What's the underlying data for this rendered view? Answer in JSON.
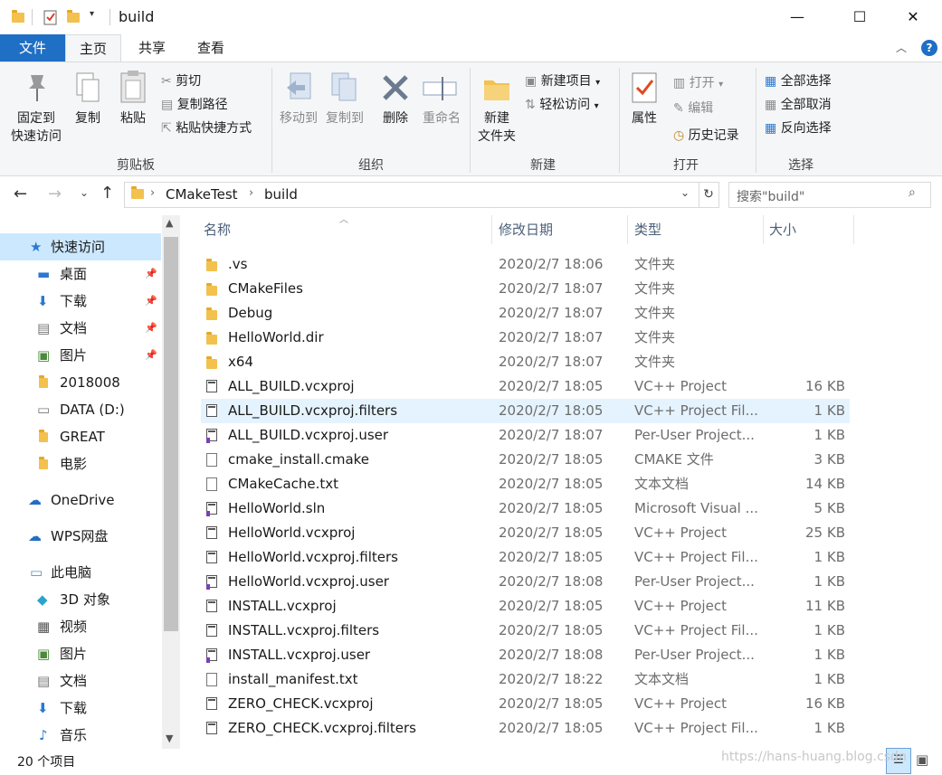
{
  "title": "build",
  "tabs": [
    {
      "label": "文件"
    },
    {
      "label": "主页"
    },
    {
      "label": "共享"
    },
    {
      "label": "查看"
    }
  ],
  "ribbon": {
    "clipboard": {
      "pin_label": "固定到\n快速访问",
      "copy_label": "复制",
      "paste_label": "粘贴",
      "cut_label": "剪切",
      "copy_path_label": "复制路径",
      "paste_shortcut_label": "粘贴快捷方式",
      "group_label": "剪贴板"
    },
    "organize": {
      "move_to_label": "移动到",
      "copy_to_label": "复制到",
      "delete_label": "删除",
      "rename_label": "重命名",
      "group_label": "组织"
    },
    "new": {
      "new_folder_label": "新建\n文件夹",
      "new_item_label": "新建项目",
      "easy_access_label": "轻松访问",
      "group_label": "新建"
    },
    "open": {
      "properties_label": "属性",
      "open_label": "打开",
      "edit_label": "编辑",
      "history_label": "历史记录",
      "group_label": "打开"
    },
    "select": {
      "select_all_label": "全部选择",
      "select_none_label": "全部取消",
      "invert_label": "反向选择",
      "group_label": "选择"
    }
  },
  "address": {
    "crumbs": [
      "CMakeTest",
      "build"
    ],
    "search_placeholder": "搜索\"build\""
  },
  "sidebar": {
    "items": [
      {
        "label": "快速访问",
        "pinned": false
      },
      {
        "label": "桌面",
        "pinned": true
      },
      {
        "label": "下载",
        "pinned": true
      },
      {
        "label": "文档",
        "pinned": true
      },
      {
        "label": "图片",
        "pinned": true
      },
      {
        "label": "2018008",
        "pinned": false
      },
      {
        "label": "DATA (D:)",
        "pinned": false
      },
      {
        "label": "GREAT",
        "pinned": false
      },
      {
        "label": "电影",
        "pinned": false
      },
      {
        "label": "OneDrive",
        "pinned": false
      },
      {
        "label": "WPS网盘",
        "pinned": false
      },
      {
        "label": "此电脑",
        "pinned": false
      },
      {
        "label": "3D 对象",
        "pinned": false
      },
      {
        "label": "视频",
        "pinned": false
      },
      {
        "label": "图片",
        "pinned": false
      },
      {
        "label": "文档",
        "pinned": false
      },
      {
        "label": "下载",
        "pinned": false
      },
      {
        "label": "音乐",
        "pinned": false
      }
    ]
  },
  "columns": {
    "name": "名称",
    "date": "修改日期",
    "type": "类型",
    "size": "大小"
  },
  "files": [
    {
      "name": ".vs",
      "date": "2020/2/7 18:06",
      "type": "文件夹",
      "size": "",
      "kind": "folder"
    },
    {
      "name": "CMakeFiles",
      "date": "2020/2/7 18:07",
      "type": "文件夹",
      "size": "",
      "kind": "folder"
    },
    {
      "name": "Debug",
      "date": "2020/2/7 18:07",
      "type": "文件夹",
      "size": "",
      "kind": "folder"
    },
    {
      "name": "HelloWorld.dir",
      "date": "2020/2/7 18:07",
      "type": "文件夹",
      "size": "",
      "kind": "folder"
    },
    {
      "name": "x64",
      "date": "2020/2/7 18:07",
      "type": "文件夹",
      "size": "",
      "kind": "folder"
    },
    {
      "name": "ALL_BUILD.vcxproj",
      "date": "2020/2/7 18:05",
      "type": "VC++ Project",
      "size": "16 KB",
      "kind": "vcx"
    },
    {
      "name": "ALL_BUILD.vcxproj.filters",
      "date": "2020/2/7 18:05",
      "type": "VC++ Project Fil...",
      "size": "1 KB",
      "kind": "vcx"
    },
    {
      "name": "ALL_BUILD.vcxproj.user",
      "date": "2020/2/7 18:07",
      "type": "Per-User Project...",
      "size": "1 KB",
      "kind": "user"
    },
    {
      "name": "cmake_install.cmake",
      "date": "2020/2/7 18:05",
      "type": "CMAKE 文件",
      "size": "3 KB",
      "kind": "file"
    },
    {
      "name": "CMakeCache.txt",
      "date": "2020/2/7 18:05",
      "type": "文本文档",
      "size": "14 KB",
      "kind": "file"
    },
    {
      "name": "HelloWorld.sln",
      "date": "2020/2/7 18:05",
      "type": "Microsoft Visual ...",
      "size": "5 KB",
      "kind": "user"
    },
    {
      "name": "HelloWorld.vcxproj",
      "date": "2020/2/7 18:05",
      "type": "VC++ Project",
      "size": "25 KB",
      "kind": "vcx"
    },
    {
      "name": "HelloWorld.vcxproj.filters",
      "date": "2020/2/7 18:05",
      "type": "VC++ Project Fil...",
      "size": "1 KB",
      "kind": "vcx"
    },
    {
      "name": "HelloWorld.vcxproj.user",
      "date": "2020/2/7 18:08",
      "type": "Per-User Project...",
      "size": "1 KB",
      "kind": "user"
    },
    {
      "name": "INSTALL.vcxproj",
      "date": "2020/2/7 18:05",
      "type": "VC++ Project",
      "size": "11 KB",
      "kind": "vcx"
    },
    {
      "name": "INSTALL.vcxproj.filters",
      "date": "2020/2/7 18:05",
      "type": "VC++ Project Fil...",
      "size": "1 KB",
      "kind": "vcx"
    },
    {
      "name": "INSTALL.vcxproj.user",
      "date": "2020/2/7 18:08",
      "type": "Per-User Project...",
      "size": "1 KB",
      "kind": "user"
    },
    {
      "name": "install_manifest.txt",
      "date": "2020/2/7 18:22",
      "type": "文本文档",
      "size": "1 KB",
      "kind": "file"
    },
    {
      "name": "ZERO_CHECK.vcxproj",
      "date": "2020/2/7 18:05",
      "type": "VC++ Project",
      "size": "16 KB",
      "kind": "vcx"
    },
    {
      "name": "ZERO_CHECK.vcxproj.filters",
      "date": "2020/2/7 18:05",
      "type": "VC++ Project Fil...",
      "size": "1 KB",
      "kind": "vcx"
    }
  ],
  "status": {
    "count": "20 个项目",
    "watermark": "https://hans-huang.blog.csdn"
  },
  "colors": {
    "accent": "#1f6fc4",
    "selected": "#cce8ff",
    "hover": "#e5f3ff",
    "folder": "#f2c14e"
  }
}
